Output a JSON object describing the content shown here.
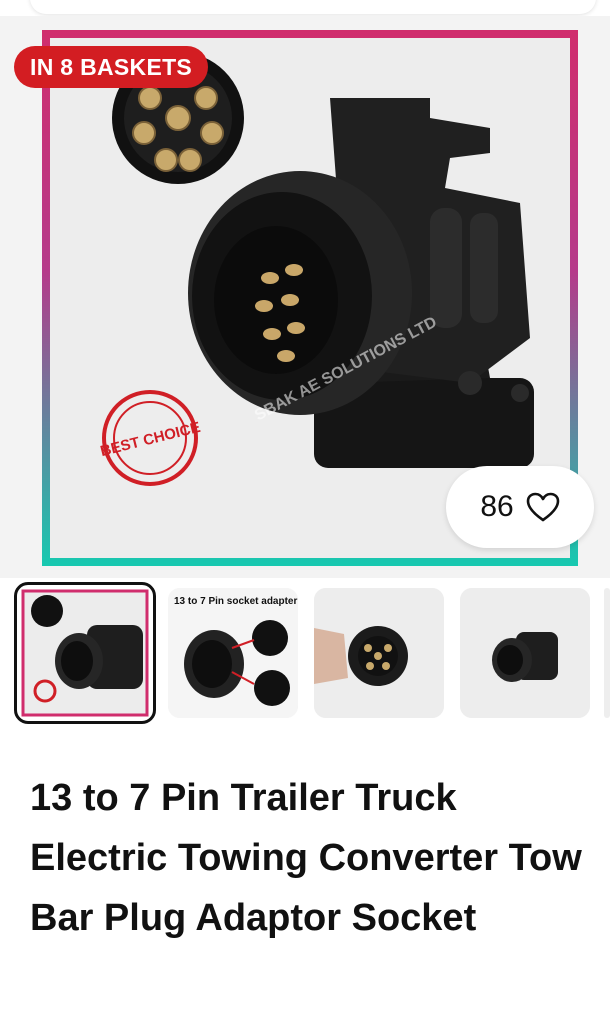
{
  "listing": {
    "basket_badge": "IN 8 BASKETS",
    "like_count": "86",
    "watermark": "SBAK AE SOLUTIONS LTD",
    "stamp_text": "BEST CHOICE",
    "title": "13 to 7 Pin Trailer Truck Electric Towing Converter Tow Bar Plug Adaptor Socket"
  },
  "thumbnails": [
    {
      "label": "",
      "selected": true
    },
    {
      "label": "13 to 7 Pin socket adapter",
      "selected": false
    },
    {
      "label": "",
      "selected": false
    },
    {
      "label": "",
      "selected": false
    }
  ],
  "colors": {
    "badge": "#d31d22",
    "frame_top": "#d02d6d",
    "frame_bottom": "#17c9b0",
    "product": "#1b1b1b"
  }
}
